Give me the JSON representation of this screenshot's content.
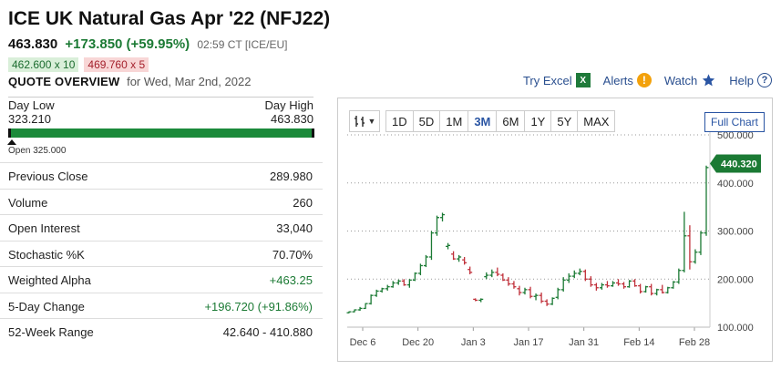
{
  "header": {
    "title": "ICE UK Natural Gas Apr '22 (NFJ22)",
    "last": "463.830",
    "change": "+173.850 (+59.95%)",
    "time": "02:59 CT [ICE/EU]",
    "bid": "462.600 x 10",
    "ask": "469.760 x 5",
    "overview_label": "QUOTE OVERVIEW",
    "overview_date": "for Wed, Mar 2nd, 2022"
  },
  "toolbar": {
    "excel": "Try Excel",
    "alerts": "Alerts",
    "watch": "Watch",
    "help": "Help"
  },
  "range": {
    "low_label": "Day Low",
    "high_label": "Day High",
    "low": "323.210",
    "high": "463.830",
    "open": "Open 325.000",
    "open_fraction": 0.012
  },
  "stats": [
    {
      "label": "Previous Close",
      "value": "289.980",
      "tone": ""
    },
    {
      "label": "Volume",
      "value": "260",
      "tone": ""
    },
    {
      "label": "Open Interest",
      "value": "33,040",
      "tone": ""
    },
    {
      "label": "Stochastic %K",
      "value": "70.70%",
      "tone": ""
    },
    {
      "label": "Weighted Alpha",
      "value": "+463.25",
      "tone": "pos"
    },
    {
      "label": "5-Day Change",
      "value": "+196.720 (+91.86%)",
      "tone": "pos"
    },
    {
      "label": "52-Week Range",
      "value": "42.640 - 410.880",
      "tone": ""
    }
  ],
  "chart_controls": {
    "chart_type_icon": "ohlc-bars-icon",
    "timeframes": [
      "1D",
      "5D",
      "1M",
      "3M",
      "6M",
      "1Y",
      "5Y",
      "MAX"
    ],
    "active": "3M",
    "full_chart": "Full Chart"
  },
  "chart_data": {
    "type": "ohlc",
    "x_labels": [
      "Dec 6",
      "Dec 20",
      "Jan 3",
      "Jan 17",
      "Jan 31",
      "Feb 14",
      "Feb 28"
    ],
    "y_ticks": [
      "100.000",
      "200.000",
      "300.000",
      "400.000",
      "500.000"
    ],
    "ylim": [
      100,
      500
    ],
    "last_value": "440.320",
    "up_color": "#1b7a34",
    "down_color": "#c0303a",
    "tag_color": "#1b7a34",
    "bars": [
      [
        130,
        133,
        129,
        132
      ],
      [
        132,
        137,
        131,
        136
      ],
      [
        136,
        142,
        134,
        139
      ],
      [
        139,
        150,
        138,
        149
      ],
      [
        149,
        168,
        147,
        166
      ],
      [
        166,
        178,
        163,
        175
      ],
      [
        175,
        182,
        172,
        180
      ],
      [
        180,
        188,
        176,
        184
      ],
      [
        184,
        196,
        182,
        192
      ],
      [
        192,
        199,
        188,
        196
      ],
      [
        196,
        200,
        186,
        188
      ],
      [
        188,
        200,
        182,
        198
      ],
      [
        198,
        214,
        196,
        212
      ],
      [
        212,
        232,
        208,
        228
      ],
      [
        228,
        250,
        225,
        246
      ],
      [
        246,
        300,
        240,
        296
      ],
      [
        296,
        332,
        290,
        328
      ],
      [
        328,
        338,
        320,
        334
      ],
      [
        268,
        275,
        262,
        270
      ],
      [
        252,
        258,
        240,
        242
      ],
      [
        242,
        250,
        236,
        246
      ],
      [
        240,
        246,
        230,
        234
      ],
      [
        220,
        226,
        210,
        214
      ],
      [
        158,
        160,
        154,
        156
      ],
      [
        156,
        160,
        152,
        158
      ],
      [
        205,
        214,
        200,
        208
      ],
      [
        208,
        220,
        204,
        214
      ],
      [
        214,
        224,
        206,
        210
      ],
      [
        208,
        212,
        196,
        198
      ],
      [
        198,
        204,
        186,
        190
      ],
      [
        190,
        196,
        180,
        184
      ],
      [
        180,
        186,
        166,
        172
      ],
      [
        172,
        182,
        168,
        178
      ],
      [
        178,
        184,
        160,
        164
      ],
      [
        164,
        170,
        156,
        166
      ],
      [
        166,
        172,
        150,
        154
      ],
      [
        154,
        158,
        144,
        148
      ],
      [
        148,
        162,
        146,
        160
      ],
      [
        162,
        182,
        158,
        178
      ],
      [
        178,
        204,
        174,
        198
      ],
      [
        198,
        212,
        192,
        206
      ],
      [
        206,
        218,
        202,
        212
      ],
      [
        212,
        222,
        208,
        216
      ],
      [
        216,
        220,
        196,
        200
      ],
      [
        200,
        206,
        184,
        188
      ],
      [
        188,
        192,
        176,
        182
      ],
      [
        182,
        192,
        178,
        188
      ],
      [
        188,
        196,
        182,
        186
      ],
      [
        186,
        196,
        184,
        192
      ],
      [
        192,
        200,
        186,
        190
      ],
      [
        190,
        194,
        180,
        184
      ],
      [
        184,
        198,
        182,
        196
      ],
      [
        196,
        200,
        184,
        186
      ],
      [
        186,
        190,
        170,
        174
      ],
      [
        174,
        186,
        172,
        184
      ],
      [
        184,
        190,
        166,
        170
      ],
      [
        170,
        180,
        166,
        178
      ],
      [
        178,
        188,
        170,
        172
      ],
      [
        172,
        184,
        170,
        182
      ],
      [
        182,
        196,
        180,
        194
      ],
      [
        194,
        222,
        190,
        218
      ],
      [
        218,
        340,
        214,
        290
      ],
      [
        290,
        312,
        220,
        236
      ],
      [
        236,
        262,
        232,
        256
      ],
      [
        256,
        300,
        250,
        296
      ],
      [
        296,
        436,
        290,
        432
      ]
    ]
  }
}
